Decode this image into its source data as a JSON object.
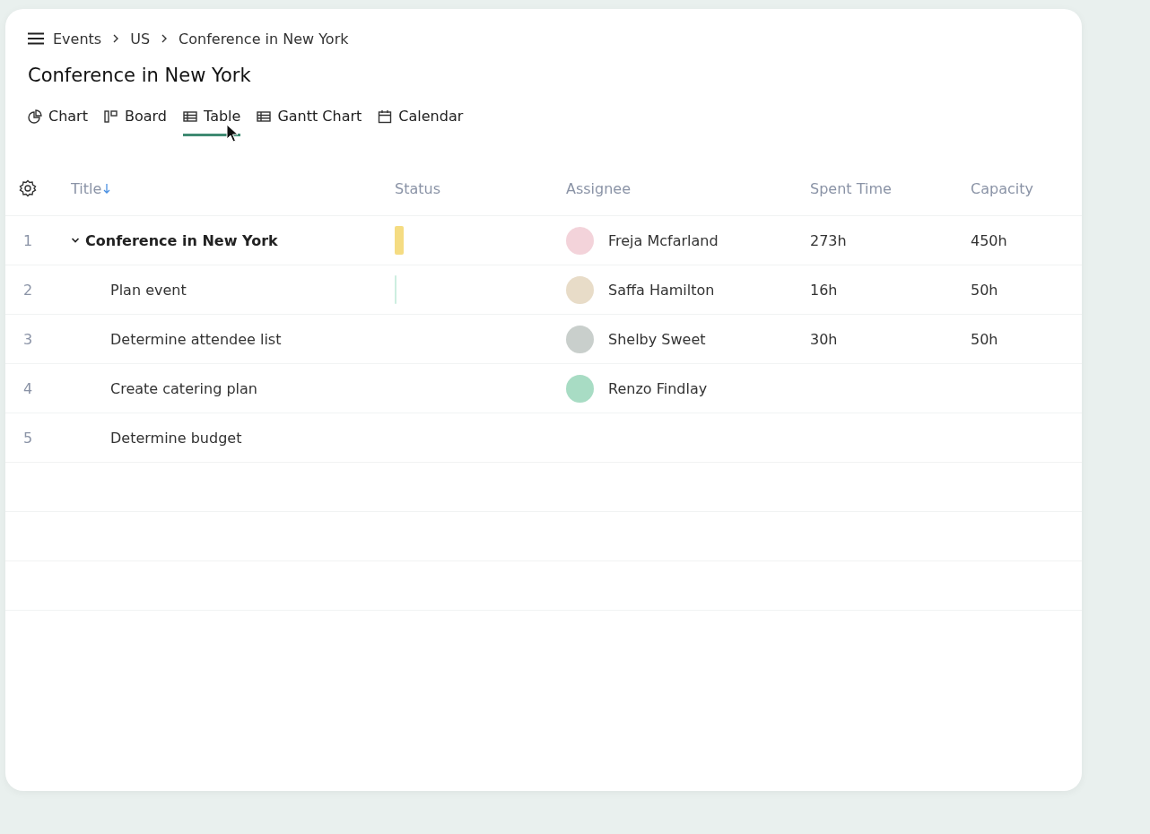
{
  "breadcrumb": [
    "Events",
    "US",
    "Conference in New York"
  ],
  "title": "Conference in New York",
  "tabs": [
    {
      "label": "Chart",
      "kind": "chart",
      "selected": false
    },
    {
      "label": "Board",
      "kind": "board",
      "selected": false
    },
    {
      "label": "Table",
      "kind": "table",
      "selected": true
    },
    {
      "label": "Gantt Chart",
      "kind": "table",
      "selected": false
    },
    {
      "label": "Calendar",
      "kind": "calendar",
      "selected": false
    }
  ],
  "table": {
    "columns": [
      {
        "label": "Title",
        "sorted": true
      },
      {
        "label": "Status",
        "sorted": false
      },
      {
        "label": "Assignee",
        "sorted": false
      },
      {
        "label": "Spent Time",
        "sorted": false
      },
      {
        "label": "Capacity",
        "sorted": false
      }
    ],
    "rows": [
      {
        "number": "1",
        "title": "Conference in New York",
        "expanded": true,
        "status": {
          "color": "#f5dc82"
        },
        "assignee": {
          "name": "Freja Mcfarland",
          "color": "#f3d3da"
        },
        "spent": "273h",
        "capacity": "450h",
        "children": [
          {
            "number": "2",
            "title": "Plan event",
            "status": {
              "color": "#cdeee0"
            },
            "assignee": {
              "name": "Saffa Hamilton",
              "color": "#e8dcc8"
            },
            "spent": "16h",
            "capacity": "50h"
          },
          {
            "number": "3",
            "title": "Determine attendee list",
            "assignee": {
              "name": "Shelby Sweet",
              "color": "#c9cfcc"
            },
            "spent": "30h",
            "capacity": "50h"
          },
          {
            "number": "4",
            "title": "Create catering plan",
            "assignee": {
              "name": "Renzo Findlay",
              "color": "#a8dcc4"
            }
          },
          {
            "number": "5",
            "title": "Determine budget"
          }
        ]
      }
    ]
  }
}
